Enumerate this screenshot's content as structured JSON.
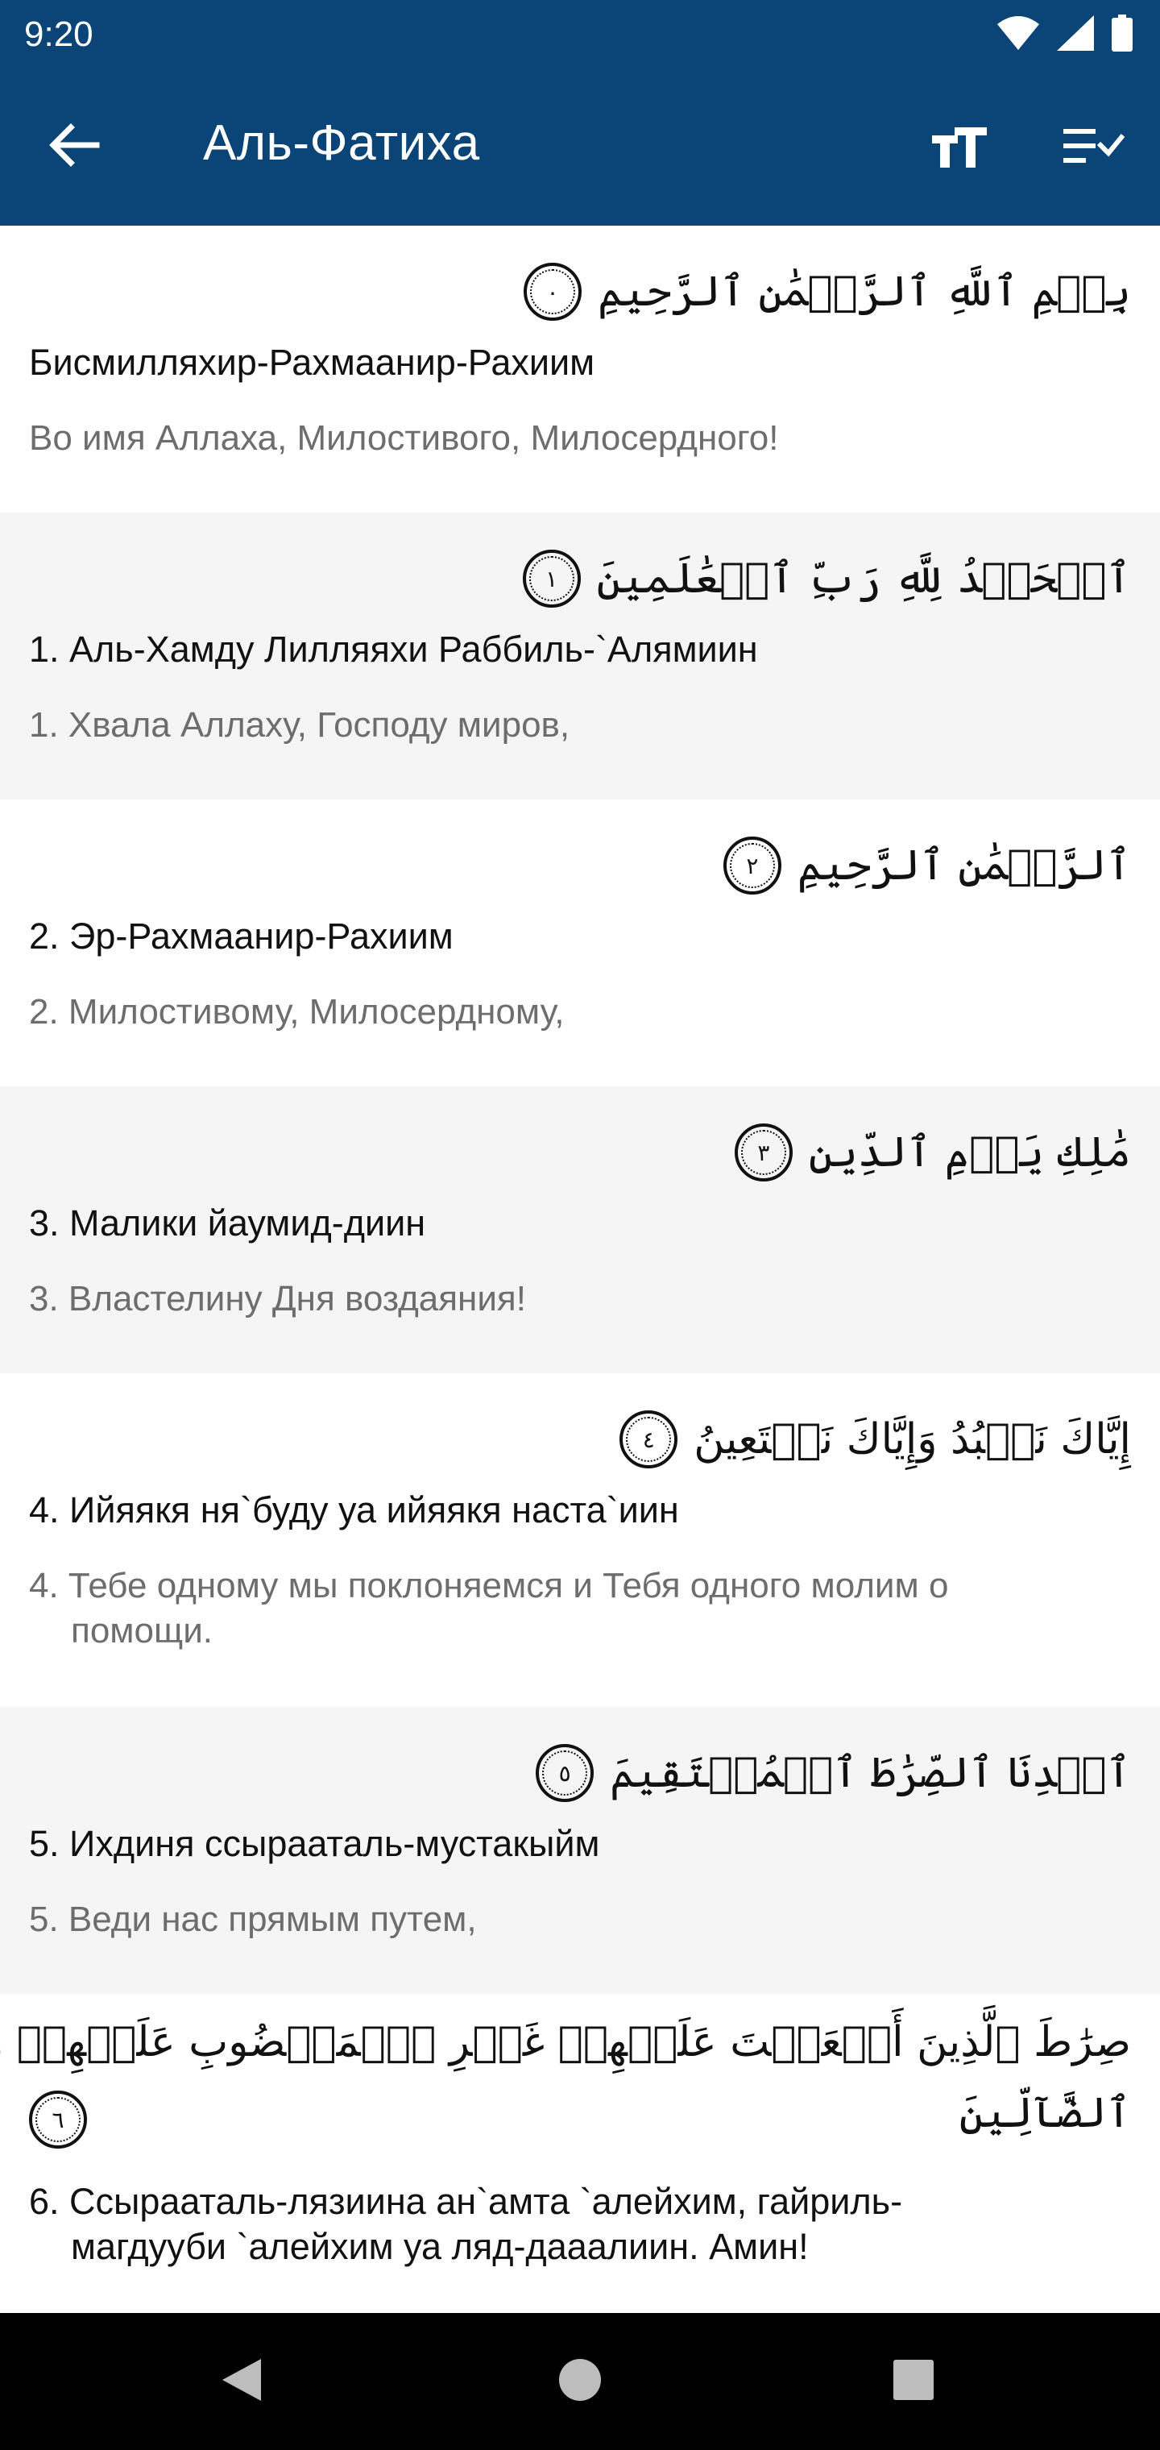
{
  "status_bar": {
    "time": "9:20",
    "icons": [
      "wifi-icon",
      "signal-icon",
      "battery-icon"
    ]
  },
  "app_bar": {
    "title": "Аль-Фатиха",
    "back_icon": "arrow-back-icon",
    "actions": [
      "text-size-icon",
      "checklist-icon"
    ]
  },
  "colors": {
    "primary": "#0b4577",
    "alt_row": "#f5f5f5",
    "meaning_text": "#6d6d6d"
  },
  "verses": [
    {
      "arabic": "بِسۡمِ ٱللَّهِ ٱلرَّحۡمَٰنِ ٱلرَّحِيمِ",
      "number": "٠",
      "transliteration": "Бисмилляхир-Рахмаанир-Рахиим",
      "translation": "Во имя Аллаха, Милостивого, Милосердного!"
    },
    {
      "arabic": "ٱلۡحَمۡدُ لِلَّهِ رَبِّ ٱلۡعَٰلَمِينَ",
      "number": "١",
      "transliteration": "1. Аль-Хамду Лилляяхи Раббиль-`Алямиин",
      "translation": "1. Хвала Аллаху, Господу миров,"
    },
    {
      "arabic": "ٱلرَّحۡمَٰنِ ٱلرَّحِيمِ",
      "number": "٢",
      "transliteration": "2. Эр-Рахмаанир-Рахиим",
      "translation": "2. Милостивому, Милосердному,"
    },
    {
      "arabic": "مَٰلِكِ يَوۡمِ ٱلدِّينِ",
      "number": "٣",
      "transliteration": "3. Малики йаумид-диин",
      "translation": "3. Властелину Дня воздаяния!"
    },
    {
      "arabic": "إِيَّاكَ نَعۡبُدُ وَإِيَّاكَ نَسۡتَعِينُ",
      "number": "٤",
      "transliteration": "4. Ийяякя ня`буду уа ийяякя наста`иин",
      "translation": "4. Тебе одному мы поклоняемся и Тебя одного молим о помощи."
    },
    {
      "arabic": "ٱهۡدِنَا ٱلصِّرَٰطَ ٱلۡمُسۡتَقِيمَ",
      "number": "٥",
      "transliteration": "5. Ихдиня ссырааталь-мустакыйм",
      "translation": "5. Веди нас прямым путем,"
    },
    {
      "arabic_line1": "صِرَٰطَ ٱلَّذِينَ أَنۡعَمۡتَ عَلَيۡهِمۡ غَيۡرِ ٱلۡمَغۡضُوبِ عَلَيۡهِمۡ وَلَا",
      "arabic_line2": "ٱلضَّآلِّينَ",
      "number": "٦",
      "transliteration": "6. Ссырааталь-лязиина ан`амта `алейхим, гайриль-магдууби `алейхим уа ляд-дааалиин. Амин!"
    }
  ],
  "nav_bar": {
    "buttons": [
      "nav-back-icon",
      "nav-home-icon",
      "nav-recents-icon"
    ]
  }
}
